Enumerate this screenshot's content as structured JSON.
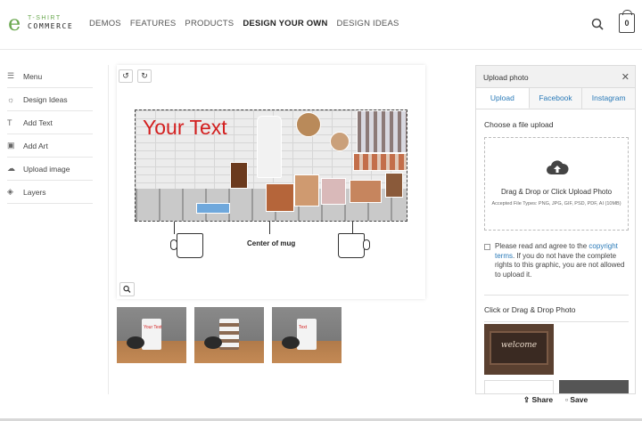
{
  "logo": {
    "top": "T-SHIRT",
    "bottom": "COMMERCE"
  },
  "nav": [
    "DEMOS",
    "FEATURES",
    "PRODUCTS",
    "DESIGN YOUR OWN",
    "DESIGN IDEAS"
  ],
  "cart": {
    "count": "0"
  },
  "sidebar": {
    "items": [
      {
        "label": "Menu",
        "icon": "menu-icon"
      },
      {
        "label": "Design Ideas",
        "icon": "lightbulb-icon"
      },
      {
        "label": "Add Text",
        "icon": "text-icon"
      },
      {
        "label": "Add Art",
        "icon": "image-icon"
      },
      {
        "label": "Upload image",
        "icon": "cloud-upload-icon"
      },
      {
        "label": "Layers",
        "icon": "layers-icon"
      }
    ]
  },
  "canvas": {
    "design_text": "Your Text",
    "center_label": "Center of mug"
  },
  "thumbnails": [
    {
      "label": "Your Text"
    },
    {
      "label": ""
    },
    {
      "label": "Text"
    }
  ],
  "upload_panel": {
    "title": "Upload photo",
    "tabs": [
      "Upload",
      "Facebook",
      "Instagram"
    ],
    "choose_label": "Choose a file upload",
    "drop_main": "Drag & Drop or Click Upload Photo",
    "drop_sub": "Accepted File Types: PNG, JPG, GIF, PSD, PDF, AI (10MB)",
    "agree_prefix": "Please read and agree to the ",
    "agree_link": "copyright terms",
    "agree_suffix": ". If you do not have the complete rights to this graphic, you are not allowed to upload it.",
    "click_drag_label": "Click or Drag & Drop Photo",
    "photo_caption": "welcome"
  },
  "actions": {
    "share": "Share",
    "save": "Save"
  },
  "colors": {
    "accent": "#2a7ab8",
    "brand": "#6aa84f",
    "design_text": "#d31f1f"
  }
}
